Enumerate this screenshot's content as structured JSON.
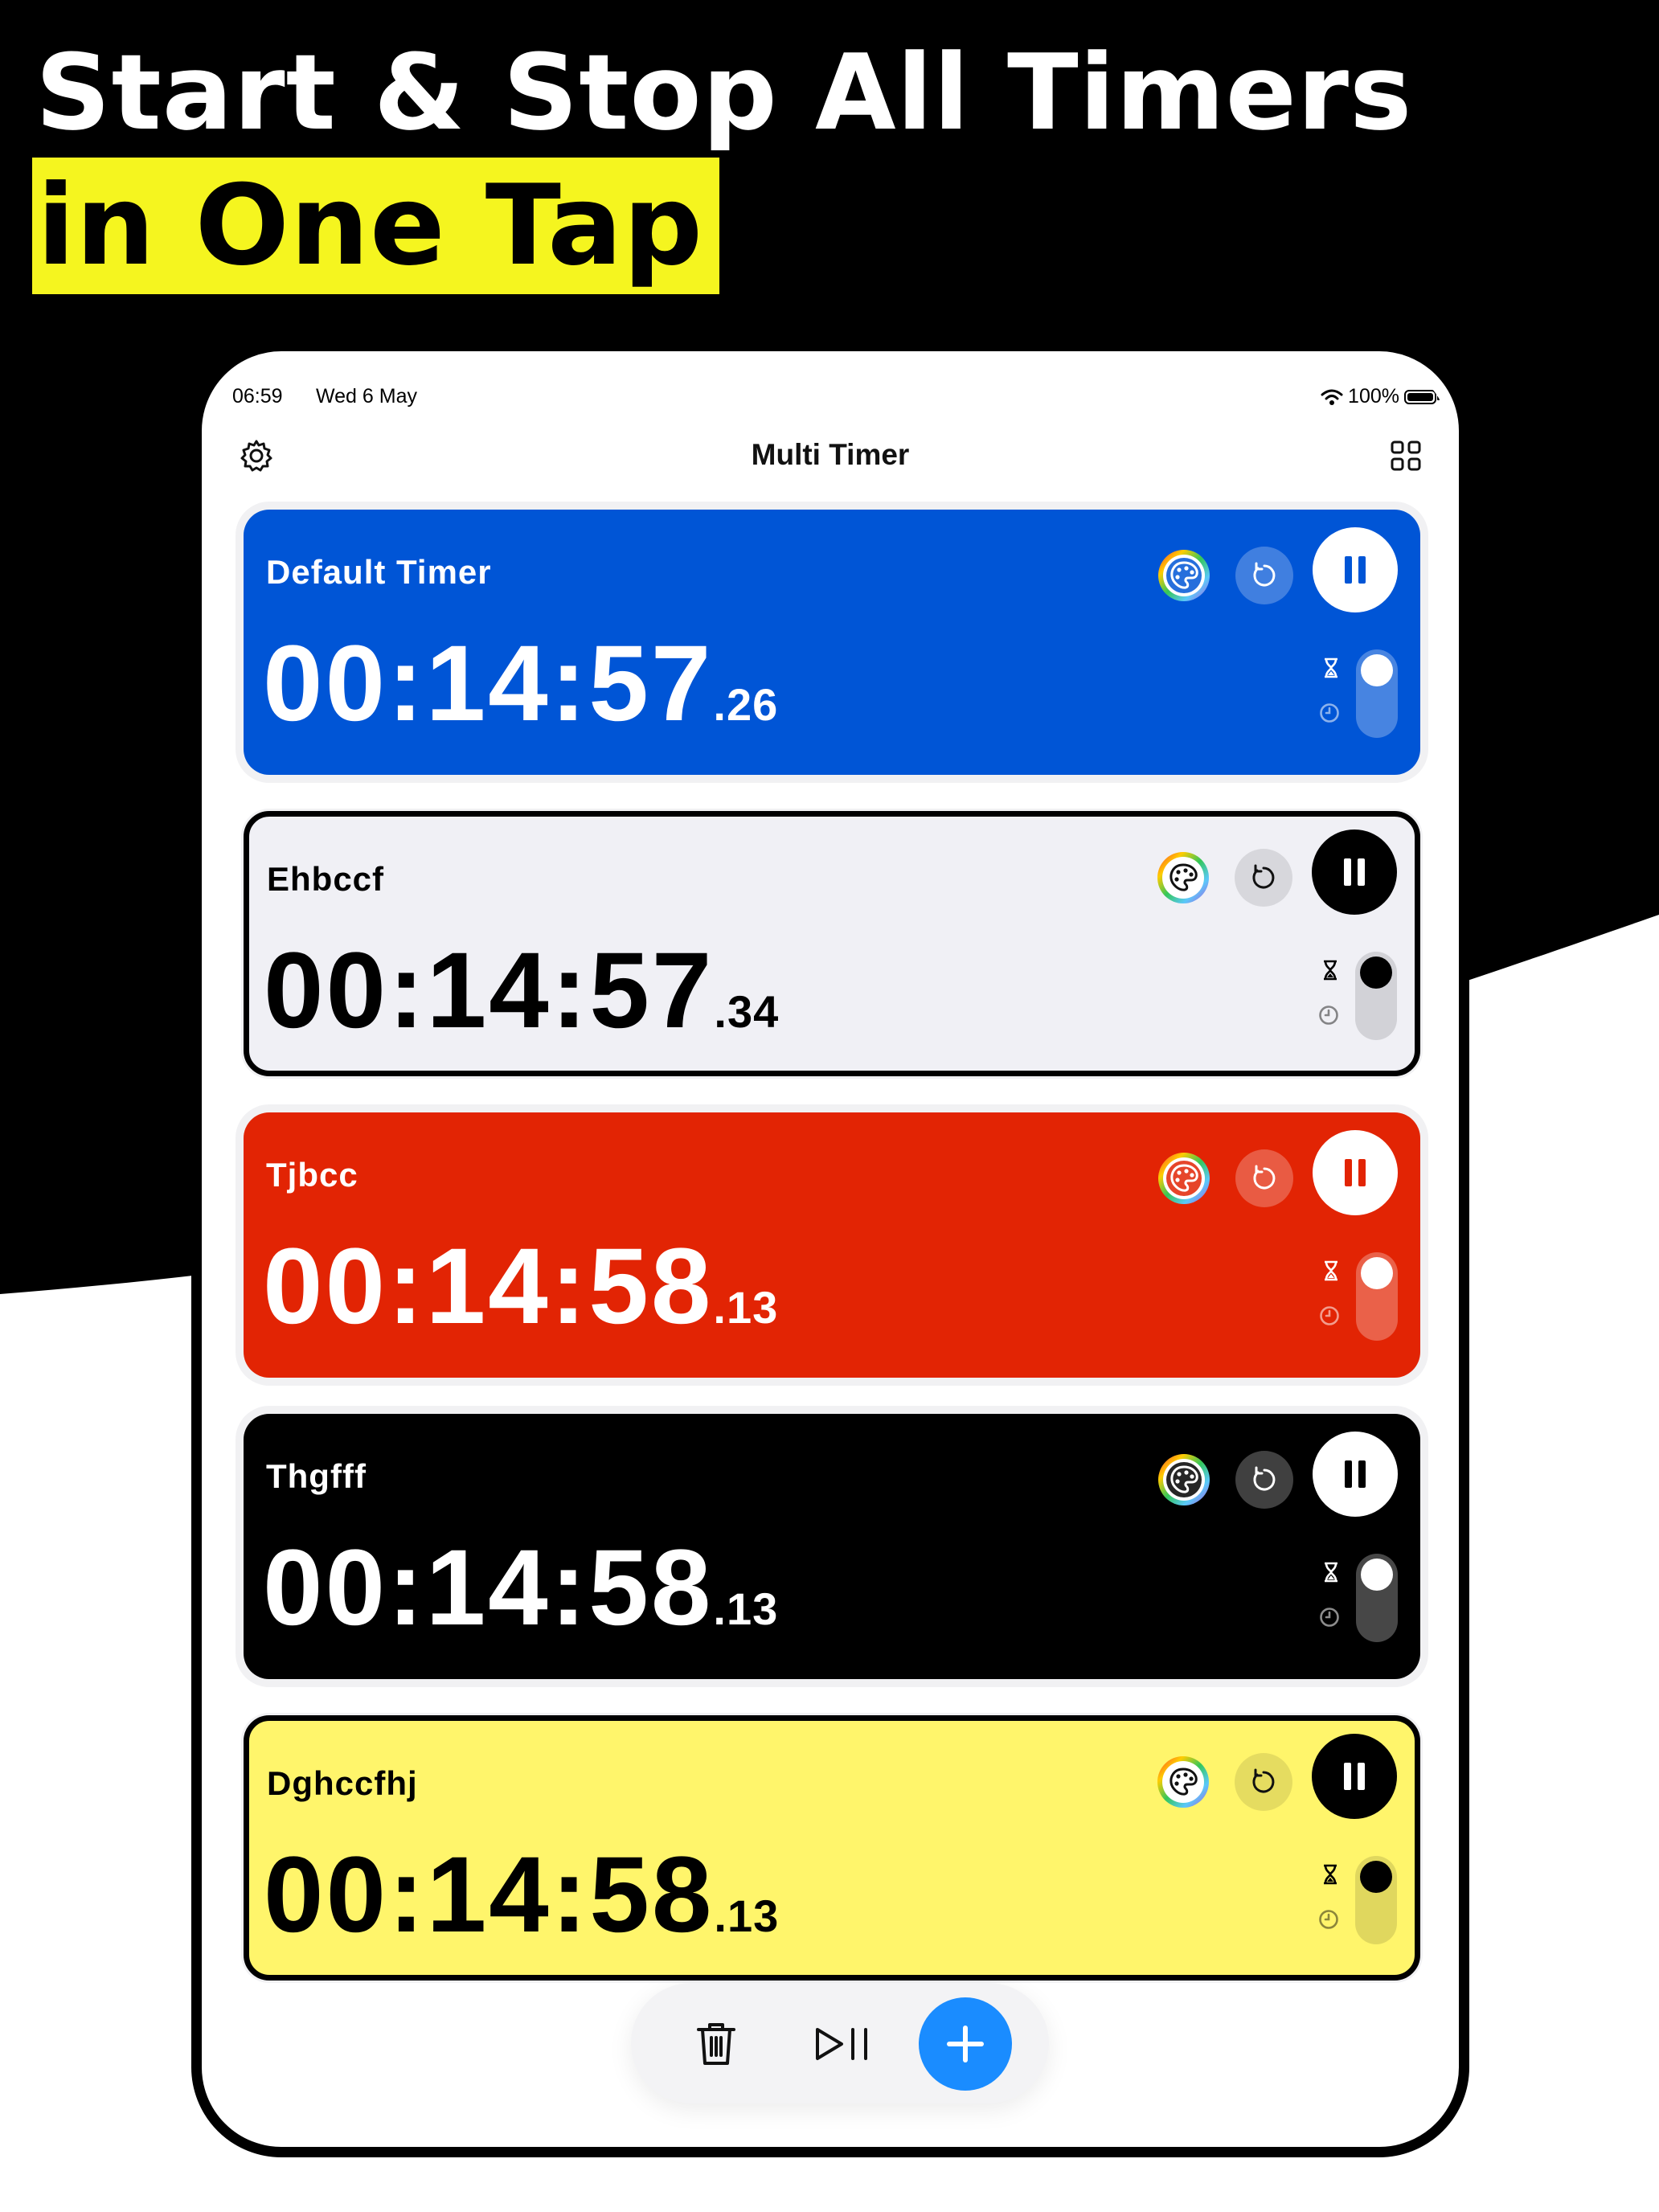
{
  "headline": {
    "line1": "Start & Stop All Timers",
    "line2": "in One Tap"
  },
  "status_bar": {
    "time": "06:59",
    "date": "Wed 6 May",
    "battery": "100%"
  },
  "nav": {
    "title": "Multi Timer"
  },
  "timers": [
    {
      "name": "Default Timer",
      "time": "00:14:57",
      "ms": ".26",
      "bg": "#0055d6",
      "fg": "#ffffff"
    },
    {
      "name": "Ehbccf",
      "time": "00:14:57",
      "ms": ".34",
      "bg": "#f0f0f5",
      "fg": "#000000"
    },
    {
      "name": "Tjbcc",
      "time": "00:14:58",
      "ms": ".13",
      "bg": "#e22404",
      "fg": "#ffffff"
    },
    {
      "name": "Thgfff",
      "time": "00:14:58",
      "ms": ".13",
      "bg": "#000000",
      "fg": "#ffffff"
    },
    {
      "name": "Dghccfhj",
      "time": "00:14:58",
      "ms": ".13",
      "bg": "#fff56b",
      "fg": "#000000"
    }
  ],
  "icons": {
    "settings": "gear-icon",
    "layout": "grid-icon",
    "palette": "palette-icon",
    "reset": "reset-icon",
    "pause": "pause-icon",
    "timer_mode": "hourglass-icon",
    "clock_mode": "clock-icon",
    "trash": "trash-icon",
    "play_pause_all": "play-pause-icon",
    "add": "plus-icon"
  },
  "colors": {
    "accent": "#1a8cff",
    "highlight": "#f5f51f"
  }
}
